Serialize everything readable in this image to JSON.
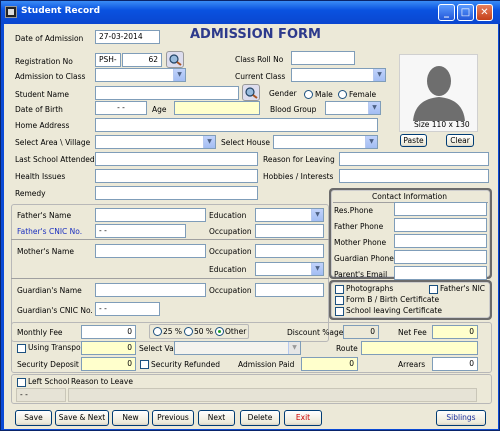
{
  "window": {
    "title": "Student Record"
  },
  "form": {
    "heading": "ADMISSION FORM"
  },
  "admission": {
    "date_label": "Date of Admission",
    "date": "27-03-2014"
  },
  "reg": {
    "label": "Registration No",
    "prefix": "PSH-",
    "number": "62"
  },
  "class_roll": {
    "label": "Class Roll No",
    "value": ""
  },
  "admission_class": {
    "label": "Admission to Class",
    "value": ""
  },
  "current_class": {
    "label": "Current Class",
    "value": ""
  },
  "student_name": {
    "label": "Student Name",
    "value": ""
  },
  "gender": {
    "label": "Gender",
    "male": "Male",
    "female": "Female"
  },
  "dob": {
    "label": "Date of Birth",
    "value": "- -"
  },
  "age": {
    "label": "Age",
    "value": ""
  },
  "blood": {
    "label": "Blood Group",
    "value": ""
  },
  "address": {
    "label": "Home Address",
    "value": ""
  },
  "area": {
    "label": "Select Area \\ Village",
    "value": ""
  },
  "house": {
    "label": "Select House",
    "value": ""
  },
  "last_school": {
    "label": "Last School Attended",
    "value": ""
  },
  "reason_leaving": {
    "label": "Reason for Leaving",
    "value": ""
  },
  "health": {
    "label": "Health Issues",
    "value": ""
  },
  "hobbies": {
    "label": "Hobbies / Interests",
    "value": ""
  },
  "remedy": {
    "label": "Remedy",
    "value": ""
  },
  "photo": {
    "size_text": "Size 110 x 130",
    "paste": "Paste",
    "clear": "Clear"
  },
  "father": {
    "name_label": "Father's Name",
    "cnic_label": "Father's CNIC No.",
    "cnic": "-    -",
    "education_label": "Education",
    "occupation_label": "Occupation"
  },
  "mother": {
    "name_label": "Mother's Name",
    "occupation_label": "Occupation",
    "education_label": "Education"
  },
  "guardian": {
    "name_label": "Guardian's Name",
    "cnic_label": "Guardian's CNIC No.",
    "cnic": "-    -",
    "occupation_label": "Occupation"
  },
  "contact": {
    "title": "Contact Information",
    "res": "Res.Phone",
    "father": "Father Phone",
    "mother": "Mother Phone",
    "guardian": "Guardian Phone",
    "email": "Parent's Email"
  },
  "docs": {
    "photographs": "Photographs",
    "father_nic": "Father's NIC",
    "formb": "Form B / Birth Certificate",
    "leaving": "School leaving Certificate"
  },
  "fees": {
    "monthly_label": "Monthly Fee",
    "monthly": "0",
    "pct25": "25 %",
    "pct50": "50 %",
    "other": "Other",
    "discount_label": "Discount %age",
    "discount": "0",
    "net_label": "Net Fee",
    "net": "0",
    "transport": "Using Transport",
    "transport_fee": "0",
    "van_label": "Select Van",
    "route_label": "Route",
    "route": "",
    "deposit_label": "Security Deposit",
    "deposit": "0",
    "refunded": "Security Refunded",
    "paid_label": "Admission Paid",
    "paid": "0",
    "arrears_label": "Arrears",
    "arrears": "0"
  },
  "left_school": {
    "label": "Left School",
    "reason_label": "Reason to Leave",
    "date": "- -",
    "reason": ""
  },
  "buttons": {
    "save": "Save",
    "save_next": "Save & Next",
    "new": "New",
    "previous": "Previous",
    "next": "Next",
    "delete": "Delete",
    "exit": "Exit",
    "siblings": "Siblings"
  },
  "colors": {
    "title_bar": "#0a52e0",
    "form_bg": "#ece9d8",
    "heading": "#2d3a8c",
    "cnic_label": "#1a2fbf",
    "exit": "#cc0000",
    "yellow_field": "#ffffcc"
  }
}
